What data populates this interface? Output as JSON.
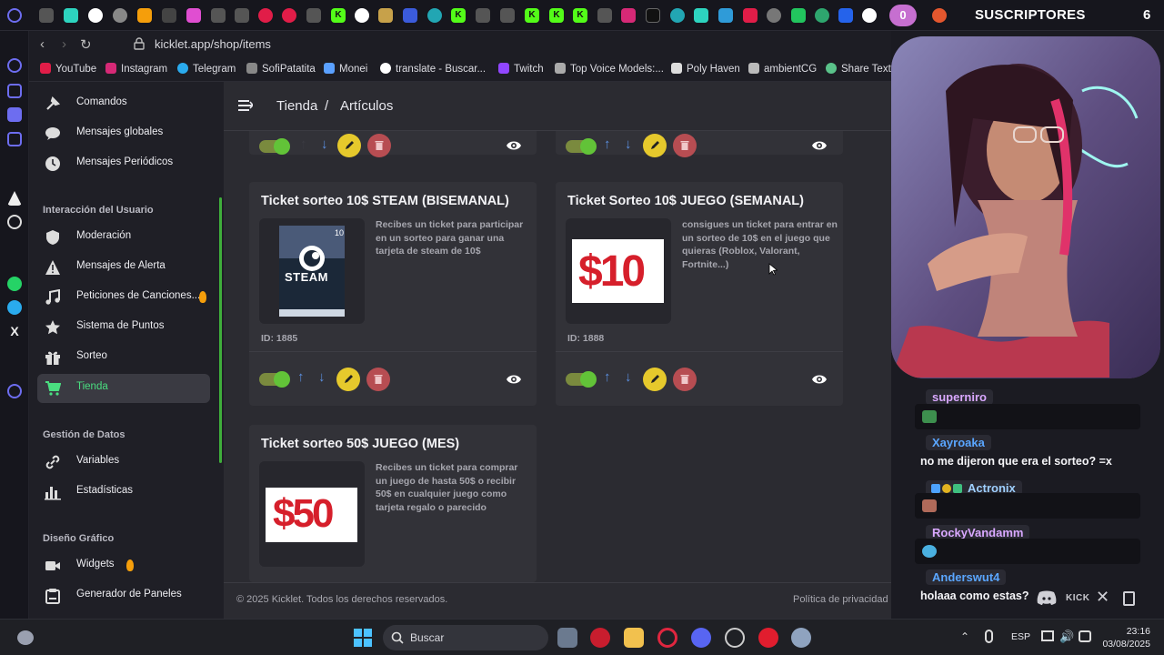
{
  "browser": {
    "url": "kicklet.app/shop/items",
    "bookmarks": [
      "YouTube",
      "Instagram",
      "Telegram",
      "SofiPatatita",
      "Monei",
      "translate - Buscar...",
      "Twitch",
      "Top Voice Models:...",
      "Poly Haven",
      "ambientCG",
      "Share Textu"
    ]
  },
  "overlay": {
    "badge": "0",
    "subscribers_label": "SUSCRIPTORES",
    "subscribers_count": "6"
  },
  "sidebar": {
    "top_items": [
      "Comandos",
      "Mensajes globales",
      "Mensajes Periódicos"
    ],
    "sections": [
      {
        "title": "Interacción del Usuario",
        "items": [
          "Moderación",
          "Mensajes de Alerta",
          "Peticiones de Canciones...",
          "Sistema de Puntos",
          "Sorteo",
          "Tienda"
        ]
      },
      {
        "title": "Gestión de Datos",
        "items": [
          "Variables",
          "Estadísticas"
        ]
      },
      {
        "title": "Diseño Gráfico",
        "items": [
          "Widgets",
          "Generador de Paneles"
        ]
      }
    ],
    "active_item": "Tienda"
  },
  "header": {
    "breadcrumb": [
      "Tienda",
      "/",
      "Artículos"
    ]
  },
  "items": [
    {
      "title": "Ticket sorteo 10$ STEAM (BISEMANAL)",
      "description": "Recibes un ticket para participar en un sorteo para ganar una tarjeta de steam de 10$",
      "id": "ID: 1885",
      "image_text": "STEAM",
      "image_value": "10"
    },
    {
      "title": "Ticket Sorteo 10$ JUEGO (SEMANAL)",
      "description": "consigues un ticket para entrar en un sorteo de 10$ en el juego que quieras (Roblox, Valorant, Fortnite...)",
      "id": "ID: 1888",
      "image_text": "$10"
    },
    {
      "title": "Ticket sorteo 50$ JUEGO (MES)",
      "description": "Recibes un ticket para comprar un juego de hasta 50$ o recibir 50$ en cualquier juego como tarjeta regalo o parecido",
      "image_text": "$50"
    }
  ],
  "footer": {
    "copyright": "© 2025 Kicklet. Todos los derechos reservados.",
    "privacy": "Política de privacidad",
    "separator": "|"
  },
  "chat": [
    {
      "user": "superniro",
      "color": "#d9a8ff",
      "text": ""
    },
    {
      "user": "Xayroaka",
      "color": "#5aa6ff",
      "text": "no me dijeron que era el sorteo? =x"
    },
    {
      "user": "Actronix",
      "color": "#9fd0ff",
      "text": ""
    },
    {
      "user": "RockyVandamm",
      "color": "#d9a8ff",
      "text": ""
    },
    {
      "user": "Anderswut4",
      "color": "#5aa6ff",
      "text": "holaaa como estas?"
    }
  ],
  "chat_footer": {
    "kick": "KICK"
  },
  "taskbar": {
    "search": "Buscar",
    "language": "ESP",
    "time": "23:16",
    "date": "03/08/2025"
  }
}
